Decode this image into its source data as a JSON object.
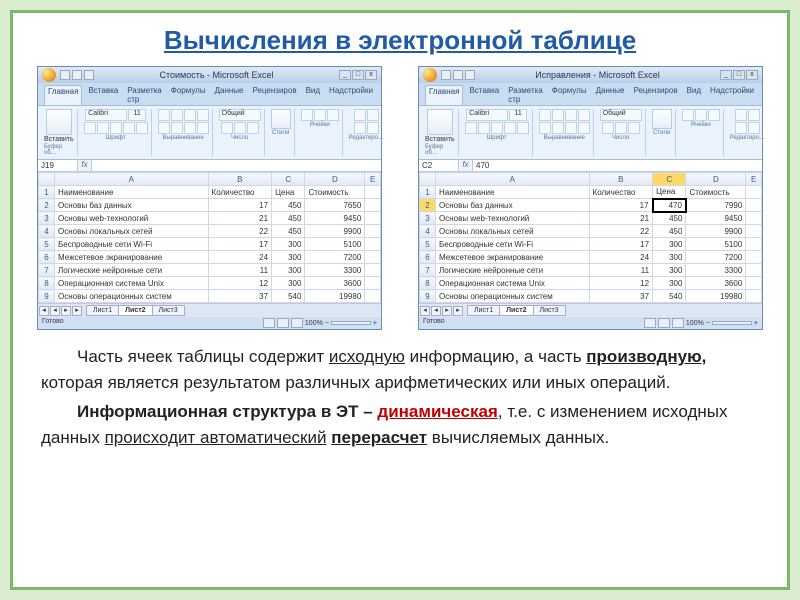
{
  "title": "Вычисления в электронной таблице",
  "excel_common": {
    "tabs": [
      "Главная",
      "Вставка",
      "Разметка стр",
      "Формулы",
      "Данные",
      "Рецензиров",
      "Вид",
      "Надстройки"
    ],
    "paste": "Вставить",
    "font": "Calibri",
    "fontsize": "11",
    "numfmt": "Общий",
    "styles": "Стили",
    "cells": "Ячейки",
    "groups": {
      "clipboard": "Буфер об…",
      "font": "Шрифт",
      "align": "Выравнивание",
      "number": "Число",
      "edit": "Редактиро…"
    },
    "sheet_tabs": [
      "Лист1",
      "Лист2",
      "Лист3"
    ],
    "zoom": "100%",
    "ready": "Готово",
    "win_min": "_",
    "win_max": "□",
    "win_close": "x",
    "cols": [
      "A",
      "B",
      "C",
      "D",
      "E"
    ],
    "headers": [
      "Наименование",
      "Количество",
      "Цена",
      "Стоимость"
    ]
  },
  "excel_left": {
    "title": "Стоимость - Microsoft Excel",
    "cell_ref": "J19",
    "formula_value": "",
    "rows": [
      [
        "Основы баз данных",
        "17",
        "450",
        "7650"
      ],
      [
        "Основы web-технологий",
        "21",
        "450",
        "9450"
      ],
      [
        "Основы локальных сетей",
        "22",
        "450",
        "9900"
      ],
      [
        "Беспроводные сети Wi-Fi",
        "17",
        "300",
        "5100"
      ],
      [
        "Межсетевое экранирование",
        "24",
        "300",
        "7200"
      ],
      [
        "Логические нейронные сети",
        "11",
        "300",
        "3300"
      ],
      [
        "Операционная система Unix",
        "12",
        "300",
        "3600"
      ],
      [
        "Основы операционных систем",
        "37",
        "540",
        "19980"
      ]
    ]
  },
  "excel_right": {
    "title": "Исправления - Microsoft Excel",
    "cell_ref": "C2",
    "formula_value": "470",
    "sel_col": 2,
    "sel_row": 0,
    "rows": [
      [
        "Основы баз данных",
        "17",
        "470",
        "7990"
      ],
      [
        "Основы web-технологий",
        "21",
        "450",
        "9450"
      ],
      [
        "Основы локальных сетей",
        "22",
        "450",
        "9900"
      ],
      [
        "Беспроводные сети Wi-Fi",
        "17",
        "300",
        "5100"
      ],
      [
        "Межсетевое экранирование",
        "24",
        "300",
        "7200"
      ],
      [
        "Логические нейронные сети",
        "11",
        "300",
        "3300"
      ],
      [
        "Операционная система Unix",
        "12",
        "300",
        "3600"
      ],
      [
        "Основы операционных систем",
        "37",
        "540",
        "19980"
      ]
    ]
  },
  "body": {
    "p1a": "Часть ячеек таблицы содержит ",
    "p1b": "исходную",
    "p1c": " информацию, а часть ",
    "p1d": "производную,",
    "p1e": " которая является результатом различных арифметических или иных операций.",
    "p2a": "Информационная структура в ЭТ – ",
    "p2b": "динамическая",
    "p2c": ", т.е. с изменением исходных данных ",
    "p2d": "происходит автоматический",
    "p2e": " ",
    "p2f": "перерасчет",
    "p2g": " вычисляемых данных."
  }
}
